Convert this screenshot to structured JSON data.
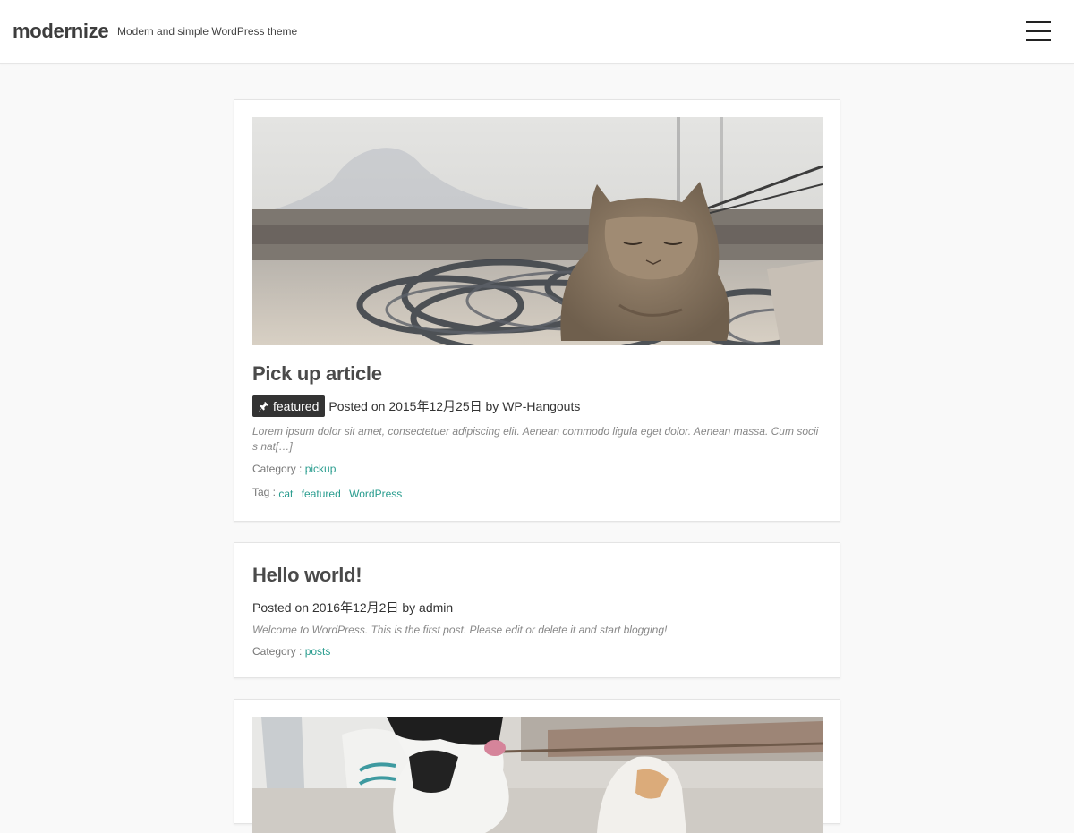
{
  "site": {
    "title": "modernize",
    "description": "Modern and simple WordPress theme"
  },
  "icons": {
    "menu": "hamburger-icon",
    "featured": "pushpin-icon"
  },
  "colors": {
    "link": "#2a9d8f",
    "badge_bg": "#333333",
    "page_bg": "#f9f9f9"
  },
  "posts": [
    {
      "title": "Pick up article",
      "badge": "featured",
      "posted_on_label": "Posted on",
      "date": "2015年12月25日",
      "by_label": "by",
      "author": "WP-Hangouts",
      "excerpt": "Lorem ipsum dolor sit amet, consectetuer adipiscing elit. Aenean commodo ligula eget dolor. Aenean massa. Cum sociis nat[…]",
      "category_label": "Category :",
      "categories": [
        "pickup"
      ],
      "tag_label": "Tag :",
      "tags": [
        "cat",
        "featured",
        "WordPress"
      ]
    },
    {
      "title": "Hello world!",
      "posted_on_label": "Posted on",
      "date": "2016年12月2日",
      "by_label": "by",
      "author": "admin",
      "excerpt": "Welcome to WordPress. This is the first post. Please edit or delete it and start blogging!",
      "category_label": "Category :",
      "categories": [
        "posts"
      ]
    }
  ]
}
